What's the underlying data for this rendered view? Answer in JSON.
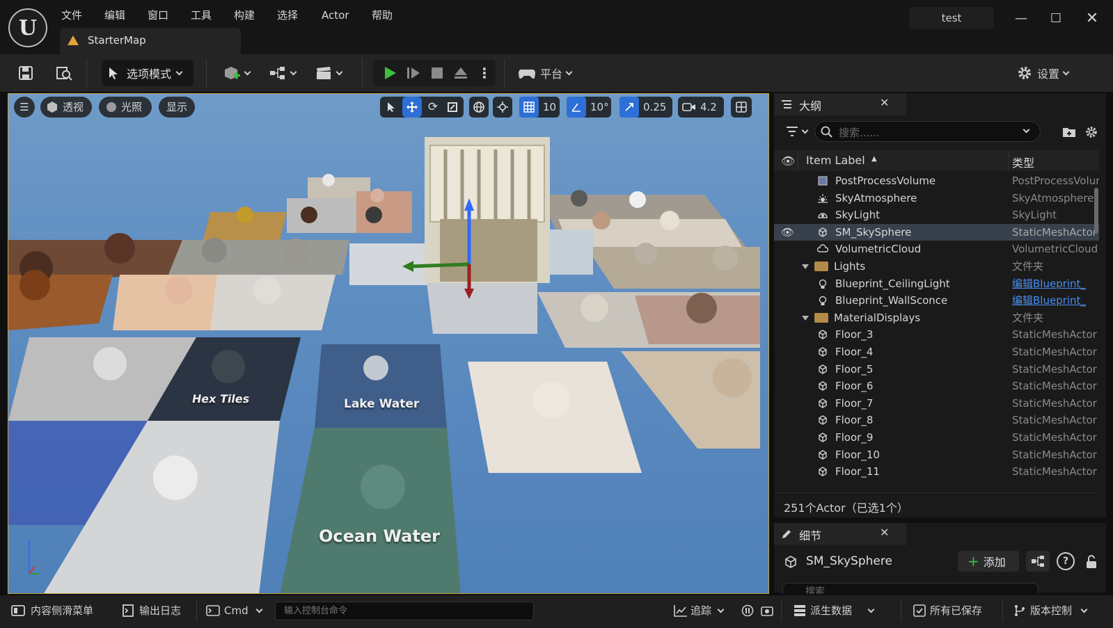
{
  "menu": [
    "文件",
    "编辑",
    "窗口",
    "工具",
    "构建",
    "选择",
    "Actor",
    "帮助"
  ],
  "document_tab": "StarterMap",
  "project_name": "test",
  "toolbar": {
    "mode_label": "选项模式",
    "platform_label": "平台",
    "settings_label": "设置"
  },
  "viewport": {
    "perspective_label": "透视",
    "lighting_label": "光照",
    "show_label": "显示",
    "grid_snap": "10",
    "rotation_snap": "10°",
    "scale_snap": "0.25",
    "camera_speed": "4.2",
    "floor_labels": {
      "hex_tiles": "Hex Tiles",
      "lake_water": "Lake Water",
      "ocean_water": "Ocean Water"
    }
  },
  "outliner": {
    "title": "大纲",
    "search_placeholder": "搜索......",
    "col_label": "Item Label",
    "col_type": "类型",
    "rows": [
      {
        "label": "PostProcessVolume",
        "type": "PostProcessVolume",
        "icon": "volume-icon",
        "indent": 2
      },
      {
        "label": "SkyAtmosphere",
        "type": "SkyAtmosphere",
        "icon": "sun-icon",
        "indent": 2
      },
      {
        "label": "SkyLight",
        "type": "SkyLight",
        "icon": "skylight-icon",
        "indent": 2
      },
      {
        "label": "SM_SkySphere",
        "type": "StaticMeshActor",
        "icon": "static-mesh-icon",
        "indent": 2,
        "selected": true
      },
      {
        "label": "VolumetricCloud",
        "type": "VolumetricCloud",
        "icon": "cloud-icon",
        "indent": 2
      },
      {
        "label": "Lights",
        "type": "文件夹",
        "icon": "folder-icon",
        "indent": 1,
        "folder": true
      },
      {
        "label": "Blueprint_CeilingLight",
        "type": "编辑Blueprint_",
        "icon": "light-icon",
        "indent": 2,
        "link": true
      },
      {
        "label": "Blueprint_WallSconce",
        "type": "编辑Blueprint_",
        "icon": "light-icon",
        "indent": 2,
        "link": true
      },
      {
        "label": "MaterialDisplays",
        "type": "文件夹",
        "icon": "folder-icon",
        "indent": 1,
        "folder": true
      },
      {
        "label": "Floor_3",
        "type": "StaticMeshActor",
        "icon": "static-mesh-icon",
        "indent": 2
      },
      {
        "label": "Floor_4",
        "type": "StaticMeshActor",
        "icon": "static-mesh-icon",
        "indent": 2
      },
      {
        "label": "Floor_5",
        "type": "StaticMeshActor",
        "icon": "static-mesh-icon",
        "indent": 2
      },
      {
        "label": "Floor_6",
        "type": "StaticMeshActor",
        "icon": "static-mesh-icon",
        "indent": 2
      },
      {
        "label": "Floor_7",
        "type": "StaticMeshActor",
        "icon": "static-mesh-icon",
        "indent": 2
      },
      {
        "label": "Floor_8",
        "type": "StaticMeshActor",
        "icon": "static-mesh-icon",
        "indent": 2
      },
      {
        "label": "Floor_9",
        "type": "StaticMeshActor",
        "icon": "static-mesh-icon",
        "indent": 2
      },
      {
        "label": "Floor_10",
        "type": "StaticMeshActor",
        "icon": "static-mesh-icon",
        "indent": 2
      },
      {
        "label": "Floor_11",
        "type": "StaticMeshActor",
        "icon": "static-mesh-icon",
        "indent": 2
      }
    ],
    "actor_count": "251个Actor（已选1个）"
  },
  "details": {
    "title": "细节",
    "object_name": "SM_SkySphere",
    "add_label": "添加",
    "search_placeholder": "搜索"
  },
  "statusbar": {
    "content_drawer": "内容侧滑菜单",
    "output_log": "输出日志",
    "cmd": "Cmd",
    "console_placeholder": "输入控制台命令",
    "trace": "追踪",
    "derived_data": "派生数据",
    "all_saved": "所有已保存",
    "source_control": "版本控制"
  },
  "colors": {
    "accent_blue": "#2d6fd6",
    "play_green": "#3fbf3f",
    "selection": "#38404c",
    "viewport_border": "#c8a040"
  }
}
